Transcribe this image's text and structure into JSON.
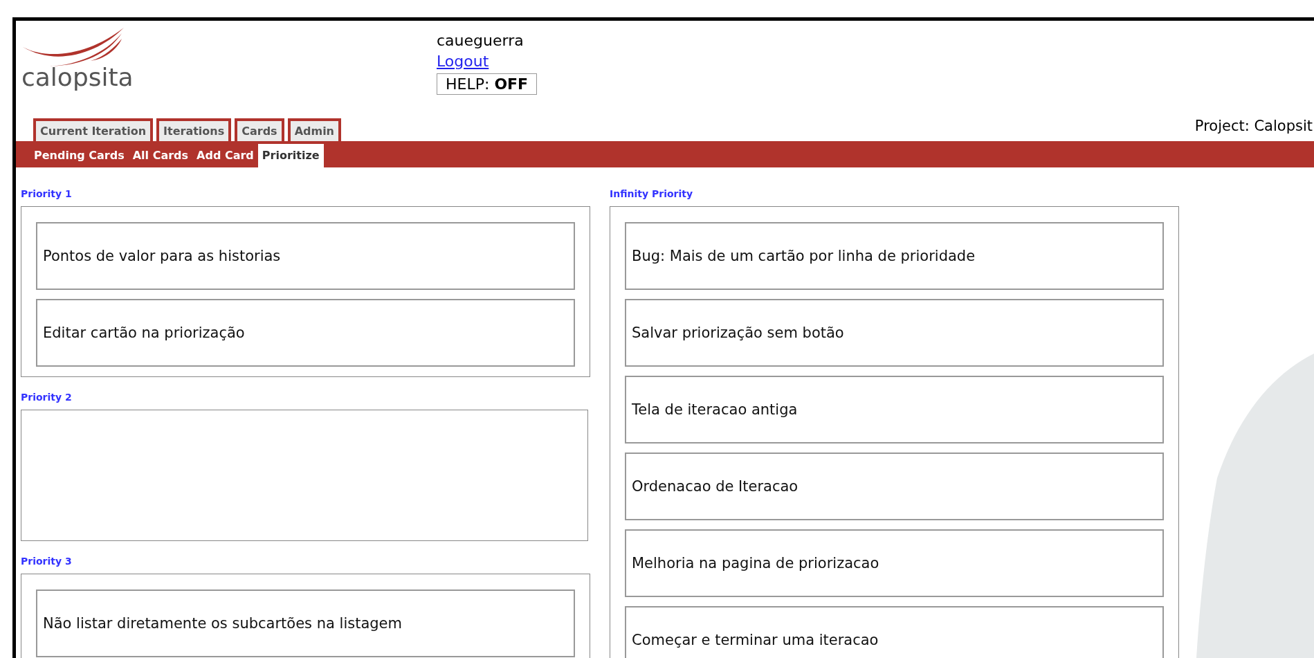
{
  "logo": {
    "text": "calopsita"
  },
  "user": {
    "name": "caueguerra",
    "logout": "Logout",
    "help": {
      "label": "HELP:",
      "value": "OFF"
    }
  },
  "tabs": [
    {
      "label": "Current Iteration"
    },
    {
      "label": "Iterations"
    },
    {
      "label": "Cards"
    },
    {
      "label": "Admin"
    }
  ],
  "subtabs": [
    {
      "label": "Pending Cards",
      "selected": false
    },
    {
      "label": "All Cards",
      "selected": false
    },
    {
      "label": "Add Card",
      "selected": false
    },
    {
      "label": "Prioritize",
      "selected": true
    }
  ],
  "project": "Project: Calopsit",
  "priority_groups": [
    {
      "title": "Priority 1",
      "cards": [
        "Pontos de valor para as historias",
        "Editar cartão na priorização"
      ]
    },
    {
      "title": "Priority 2"
    },
    {
      "title": "Priority 3",
      "cards": [
        "Não listar diretamente os subcartões na listagem"
      ]
    }
  ],
  "infinity_priority": {
    "title": "Infinity Priority",
    "cards": [
      "Bug: Mais de um cartão por linha de prioridade",
      "Salvar priorização sem botão",
      "Tela de iteracao antiga",
      "Ordenacao de Iteracao",
      "Melhoria na pagina de priorizacao",
      "Começar e terminar uma iteracao"
    ]
  }
}
